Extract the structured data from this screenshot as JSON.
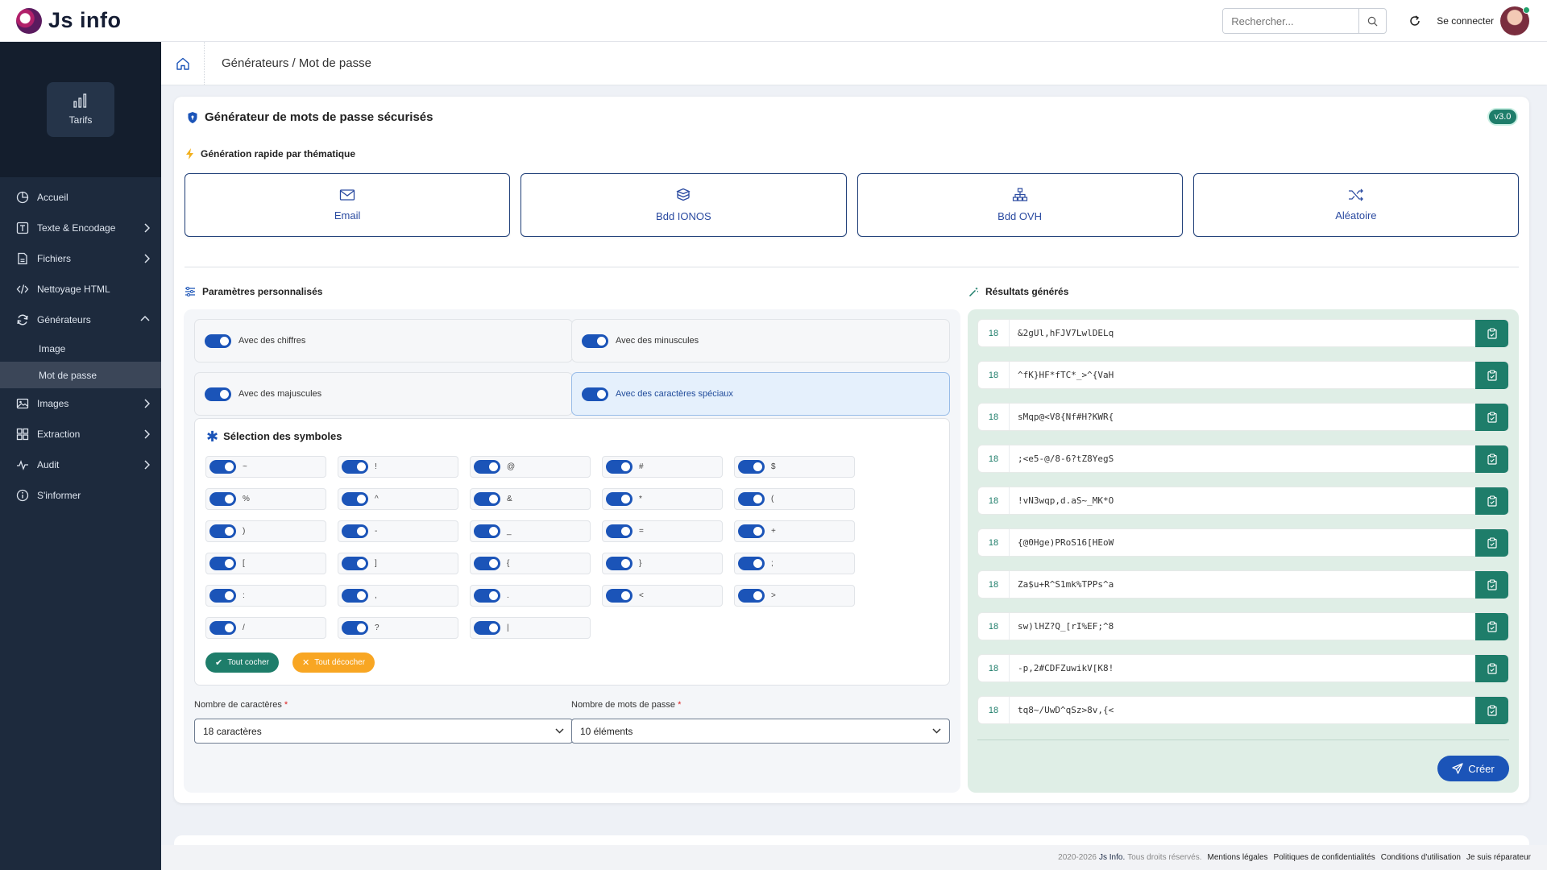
{
  "app": {
    "title": "Js info"
  },
  "topbar": {
    "search_placeholder": "Rechercher...",
    "login_label": "Se connecter"
  },
  "sidebar": {
    "tarifs_label": "Tarifs",
    "items": [
      {
        "label": "Accueil",
        "icon": "pie-chart-icon"
      },
      {
        "label": "Texte & Encodage",
        "icon": "text-icon"
      },
      {
        "label": "Fichiers",
        "icon": "file-icon"
      },
      {
        "label": "Nettoyage HTML",
        "icon": "code-icon"
      },
      {
        "label": "Générateurs",
        "icon": "refresh-icon"
      },
      {
        "label": "Images",
        "icon": "image-icon"
      },
      {
        "label": "Extraction",
        "icon": "grid-icon"
      },
      {
        "label": "Audit",
        "icon": "pulse-icon"
      },
      {
        "label": "S'informer",
        "icon": "info-icon"
      }
    ],
    "subitems": [
      {
        "label": "Image"
      },
      {
        "label": "Mot de passe"
      }
    ]
  },
  "breadcrumb": {
    "text": "Générateurs / Mot de passe"
  },
  "card": {
    "title": "Générateur de mots de passe sécurisés",
    "version": "v3.0",
    "quick_label": "Génération rapide par thématique",
    "themes": [
      {
        "label": "Email",
        "icon": "envelope-icon"
      },
      {
        "label": "Bdd IONOS",
        "icon": "database-icon"
      },
      {
        "label": "Bdd OVH",
        "icon": "network-icon"
      },
      {
        "label": "Aléatoire",
        "icon": "shuffle-icon"
      }
    ],
    "params_label": "Paramètres personnalisés",
    "results_label": "Résultats générés"
  },
  "options": {
    "digits": "Avec des chiffres",
    "lowercase": "Avec des minuscules",
    "uppercase": "Avec des majuscules",
    "special": "Avec des caractères spéciaux"
  },
  "symbols": {
    "title": "Sélection des symboles",
    "items": [
      "~",
      "!",
      "@",
      "#",
      "$",
      "%",
      "^",
      "&",
      "*",
      "(",
      ")",
      "-",
      "_",
      "=",
      "+",
      "[",
      "]",
      "{",
      "}",
      ";",
      ":",
      ",",
      ".",
      "<",
      ">",
      "/",
      "?",
      "|"
    ],
    "check_all": "Tout cocher",
    "uncheck_all": "Tout décocher"
  },
  "fields": {
    "length_label": "Nombre de caractères",
    "length_value": "18 caractères",
    "count_label": "Nombre de mots de passe",
    "count_value": "10 éléments",
    "required_mark": "*"
  },
  "results": [
    {
      "length": "18",
      "password": "&2gUl,hFJV7LwlDELq"
    },
    {
      "length": "18",
      "password": "^fK}HF*fTC*_>^{VaH"
    },
    {
      "length": "18",
      "password": "sMqp@<V8{Nf#H?KWR{"
    },
    {
      "length": "18",
      "password": ";<e5-@/8-6?tZ8YegS"
    },
    {
      "length": "18",
      "password": "!vN3wqp,d.aS~_MK*O"
    },
    {
      "length": "18",
      "password": "{@0Hge)PRoS16[HEoW"
    },
    {
      "length": "18",
      "password": "Za$u+R^S1mk%TPPs^a"
    },
    {
      "length": "18",
      "password": "sw)lHZ?Q_[rI%EF;^8"
    },
    {
      "length": "18",
      "password": "-p,2#CDFZuwikV[K8!"
    },
    {
      "length": "18",
      "password": "tq8~/UwD^qSz>8v,{<"
    }
  ],
  "create_label": "Créer",
  "footer": {
    "copyright": "2020-2026",
    "brand": "Js Info.",
    "rights": "Tous droits réservés.",
    "links": [
      "Mentions légales",
      "Politiques de confidentialités",
      "Conditions d'utilisation",
      "Je suis réparateur"
    ]
  },
  "colors": {
    "sidebar": "#1d2a3d",
    "accent_blue": "#1b54b8",
    "accent_green": "#1e7d6a",
    "accent_orange": "#f8a623"
  }
}
